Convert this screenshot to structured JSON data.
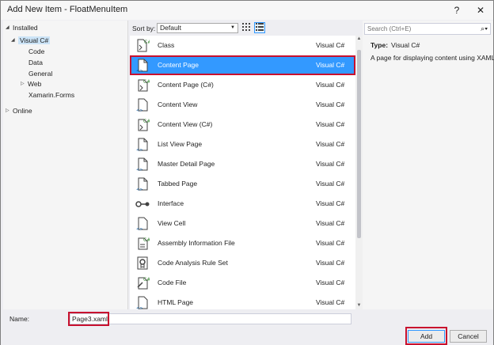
{
  "window": {
    "title": "Add New Item - FloatMenuItem",
    "help": "?",
    "close": "✕"
  },
  "tree": {
    "installed": "Installed",
    "visual_csharp": "Visual C#",
    "children": [
      "Code",
      "Data",
      "General",
      "Web",
      "Xamarin.Forms"
    ],
    "online": "Online"
  },
  "toolbar": {
    "sort_label": "Sort by:",
    "sort_value": "Default"
  },
  "items": [
    {
      "name": "Class",
      "type": "Visual C#",
      "icon": "class-icon"
    },
    {
      "name": "Content Page",
      "type": "Visual C#",
      "icon": "xaml-page-icon"
    },
    {
      "name": "Content Page (C#)",
      "type": "Visual C#",
      "icon": "cs-page-icon"
    },
    {
      "name": "Content View",
      "type": "Visual C#",
      "icon": "xaml-view-icon"
    },
    {
      "name": "Content View (C#)",
      "type": "Visual C#",
      "icon": "cs-view-icon"
    },
    {
      "name": "List View Page",
      "type": "Visual C#",
      "icon": "xaml-page-icon"
    },
    {
      "name": "Master Detail Page",
      "type": "Visual C#",
      "icon": "xaml-page-icon"
    },
    {
      "name": "Tabbed Page",
      "type": "Visual C#",
      "icon": "xaml-page-icon"
    },
    {
      "name": "Interface",
      "type": "Visual C#",
      "icon": "interface-icon"
    },
    {
      "name": "View Cell",
      "type": "Visual C#",
      "icon": "xaml-view-icon"
    },
    {
      "name": "Assembly Information File",
      "type": "Visual C#",
      "icon": "cs-file-icon"
    },
    {
      "name": "Code Analysis Rule Set",
      "type": "Visual C#",
      "icon": "ruleset-icon"
    },
    {
      "name": "Code File",
      "type": "Visual C#",
      "icon": "code-file-icon"
    },
    {
      "name": "HTML Page",
      "type": "Visual C#",
      "icon": "html-page-icon"
    }
  ],
  "selected_item": "Content Page",
  "search": {
    "placeholder": "Search (Ctrl+E)"
  },
  "details": {
    "type_label": "Type:",
    "type_value": "Visual C#",
    "description": "A page for displaying content using XAML."
  },
  "bottom": {
    "name_label": "Name:",
    "name_value": "Page3.xaml",
    "add": "Add",
    "cancel": "Cancel"
  },
  "colors": {
    "accent": "#3399ff",
    "highlight_outline": "#c8102e",
    "csharp_badge": "#388a34"
  }
}
